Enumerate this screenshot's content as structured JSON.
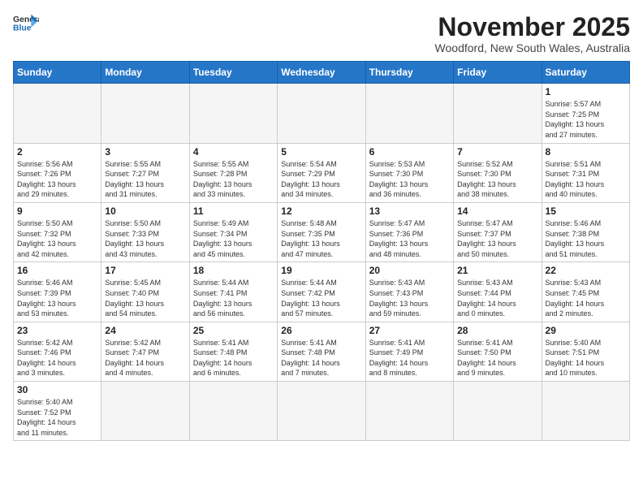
{
  "header": {
    "logo_line1": "General",
    "logo_line2": "Blue",
    "month": "November 2025",
    "location": "Woodford, New South Wales, Australia"
  },
  "days_of_week": [
    "Sunday",
    "Monday",
    "Tuesday",
    "Wednesday",
    "Thursday",
    "Friday",
    "Saturday"
  ],
  "weeks": [
    [
      {
        "day": "",
        "info": ""
      },
      {
        "day": "",
        "info": ""
      },
      {
        "day": "",
        "info": ""
      },
      {
        "day": "",
        "info": ""
      },
      {
        "day": "",
        "info": ""
      },
      {
        "day": "",
        "info": ""
      },
      {
        "day": "1",
        "info": "Sunrise: 5:57 AM\nSunset: 7:25 PM\nDaylight: 13 hours\nand 27 minutes."
      }
    ],
    [
      {
        "day": "2",
        "info": "Sunrise: 5:56 AM\nSunset: 7:26 PM\nDaylight: 13 hours\nand 29 minutes."
      },
      {
        "day": "3",
        "info": "Sunrise: 5:55 AM\nSunset: 7:27 PM\nDaylight: 13 hours\nand 31 minutes."
      },
      {
        "day": "4",
        "info": "Sunrise: 5:55 AM\nSunset: 7:28 PM\nDaylight: 13 hours\nand 33 minutes."
      },
      {
        "day": "5",
        "info": "Sunrise: 5:54 AM\nSunset: 7:29 PM\nDaylight: 13 hours\nand 34 minutes."
      },
      {
        "day": "6",
        "info": "Sunrise: 5:53 AM\nSunset: 7:30 PM\nDaylight: 13 hours\nand 36 minutes."
      },
      {
        "day": "7",
        "info": "Sunrise: 5:52 AM\nSunset: 7:30 PM\nDaylight: 13 hours\nand 38 minutes."
      },
      {
        "day": "8",
        "info": "Sunrise: 5:51 AM\nSunset: 7:31 PM\nDaylight: 13 hours\nand 40 minutes."
      }
    ],
    [
      {
        "day": "9",
        "info": "Sunrise: 5:50 AM\nSunset: 7:32 PM\nDaylight: 13 hours\nand 42 minutes."
      },
      {
        "day": "10",
        "info": "Sunrise: 5:50 AM\nSunset: 7:33 PM\nDaylight: 13 hours\nand 43 minutes."
      },
      {
        "day": "11",
        "info": "Sunrise: 5:49 AM\nSunset: 7:34 PM\nDaylight: 13 hours\nand 45 minutes."
      },
      {
        "day": "12",
        "info": "Sunrise: 5:48 AM\nSunset: 7:35 PM\nDaylight: 13 hours\nand 47 minutes."
      },
      {
        "day": "13",
        "info": "Sunrise: 5:47 AM\nSunset: 7:36 PM\nDaylight: 13 hours\nand 48 minutes."
      },
      {
        "day": "14",
        "info": "Sunrise: 5:47 AM\nSunset: 7:37 PM\nDaylight: 13 hours\nand 50 minutes."
      },
      {
        "day": "15",
        "info": "Sunrise: 5:46 AM\nSunset: 7:38 PM\nDaylight: 13 hours\nand 51 minutes."
      }
    ],
    [
      {
        "day": "16",
        "info": "Sunrise: 5:46 AM\nSunset: 7:39 PM\nDaylight: 13 hours\nand 53 minutes."
      },
      {
        "day": "17",
        "info": "Sunrise: 5:45 AM\nSunset: 7:40 PM\nDaylight: 13 hours\nand 54 minutes."
      },
      {
        "day": "18",
        "info": "Sunrise: 5:44 AM\nSunset: 7:41 PM\nDaylight: 13 hours\nand 56 minutes."
      },
      {
        "day": "19",
        "info": "Sunrise: 5:44 AM\nSunset: 7:42 PM\nDaylight: 13 hours\nand 57 minutes."
      },
      {
        "day": "20",
        "info": "Sunrise: 5:43 AM\nSunset: 7:43 PM\nDaylight: 13 hours\nand 59 minutes."
      },
      {
        "day": "21",
        "info": "Sunrise: 5:43 AM\nSunset: 7:44 PM\nDaylight: 14 hours\nand 0 minutes."
      },
      {
        "day": "22",
        "info": "Sunrise: 5:43 AM\nSunset: 7:45 PM\nDaylight: 14 hours\nand 2 minutes."
      }
    ],
    [
      {
        "day": "23",
        "info": "Sunrise: 5:42 AM\nSunset: 7:46 PM\nDaylight: 14 hours\nand 3 minutes."
      },
      {
        "day": "24",
        "info": "Sunrise: 5:42 AM\nSunset: 7:47 PM\nDaylight: 14 hours\nand 4 minutes."
      },
      {
        "day": "25",
        "info": "Sunrise: 5:41 AM\nSunset: 7:48 PM\nDaylight: 14 hours\nand 6 minutes."
      },
      {
        "day": "26",
        "info": "Sunrise: 5:41 AM\nSunset: 7:48 PM\nDaylight: 14 hours\nand 7 minutes."
      },
      {
        "day": "27",
        "info": "Sunrise: 5:41 AM\nSunset: 7:49 PM\nDaylight: 14 hours\nand 8 minutes."
      },
      {
        "day": "28",
        "info": "Sunrise: 5:41 AM\nSunset: 7:50 PM\nDaylight: 14 hours\nand 9 minutes."
      },
      {
        "day": "29",
        "info": "Sunrise: 5:40 AM\nSunset: 7:51 PM\nDaylight: 14 hours\nand 10 minutes."
      }
    ],
    [
      {
        "day": "30",
        "info": "Sunrise: 5:40 AM\nSunset: 7:52 PM\nDaylight: 14 hours\nand 11 minutes."
      },
      {
        "day": "",
        "info": ""
      },
      {
        "day": "",
        "info": ""
      },
      {
        "day": "",
        "info": ""
      },
      {
        "day": "",
        "info": ""
      },
      {
        "day": "",
        "info": ""
      },
      {
        "day": "",
        "info": ""
      }
    ]
  ]
}
